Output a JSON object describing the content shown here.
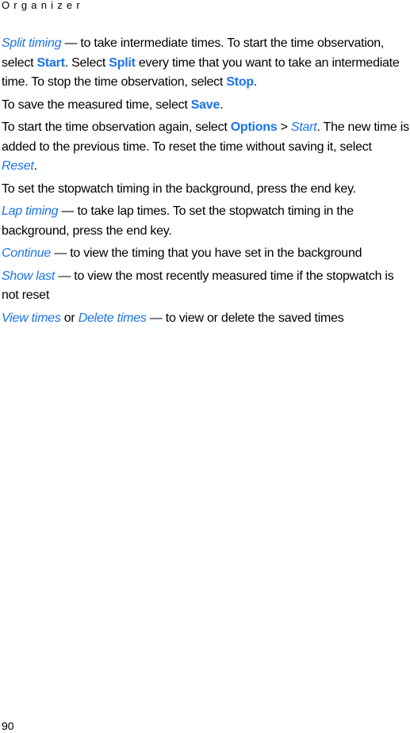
{
  "header": {
    "section_title": "Organizer"
  },
  "colors": {
    "accent": "#1a73e8",
    "text": "#000000"
  },
  "paragraphs": {
    "split": {
      "term": "Split timing",
      "t1": " — to take intermediate times. To start the time observation, select ",
      "k1": "Start",
      "t2": ". Select ",
      "k2": "Split",
      "t3": " every time that you want to take an intermediate time. To stop the time observation, select ",
      "k3": "Stop",
      "t4": "."
    },
    "save": {
      "t1": "To save the measured time, select ",
      "k1": "Save",
      "t2": "."
    },
    "restart": {
      "t1": "To start the time observation again, select ",
      "k1": "Options",
      "t2": " > ",
      "i1": "Start",
      "t3": ". The new time is added to the previous time. To reset the time without saving it, select ",
      "i2": "Reset",
      "t4": "."
    },
    "background": {
      "t1": "To set the stopwatch timing in the background, press the end key."
    },
    "lap": {
      "term": "Lap timing",
      "t1": " — to take lap times. To set the stopwatch timing in the background, press the end key."
    },
    "continue": {
      "term": "Continue",
      "t1": " — to view the timing that you have set in the background"
    },
    "showlast": {
      "term": "Show last",
      "t1": " — to view the most recently measured time if the stopwatch is not reset"
    },
    "times": {
      "term1": "View times",
      "t1": " or ",
      "term2": "Delete times",
      "t2": " — to view or delete the saved times"
    }
  },
  "footer": {
    "page_number": "90"
  }
}
